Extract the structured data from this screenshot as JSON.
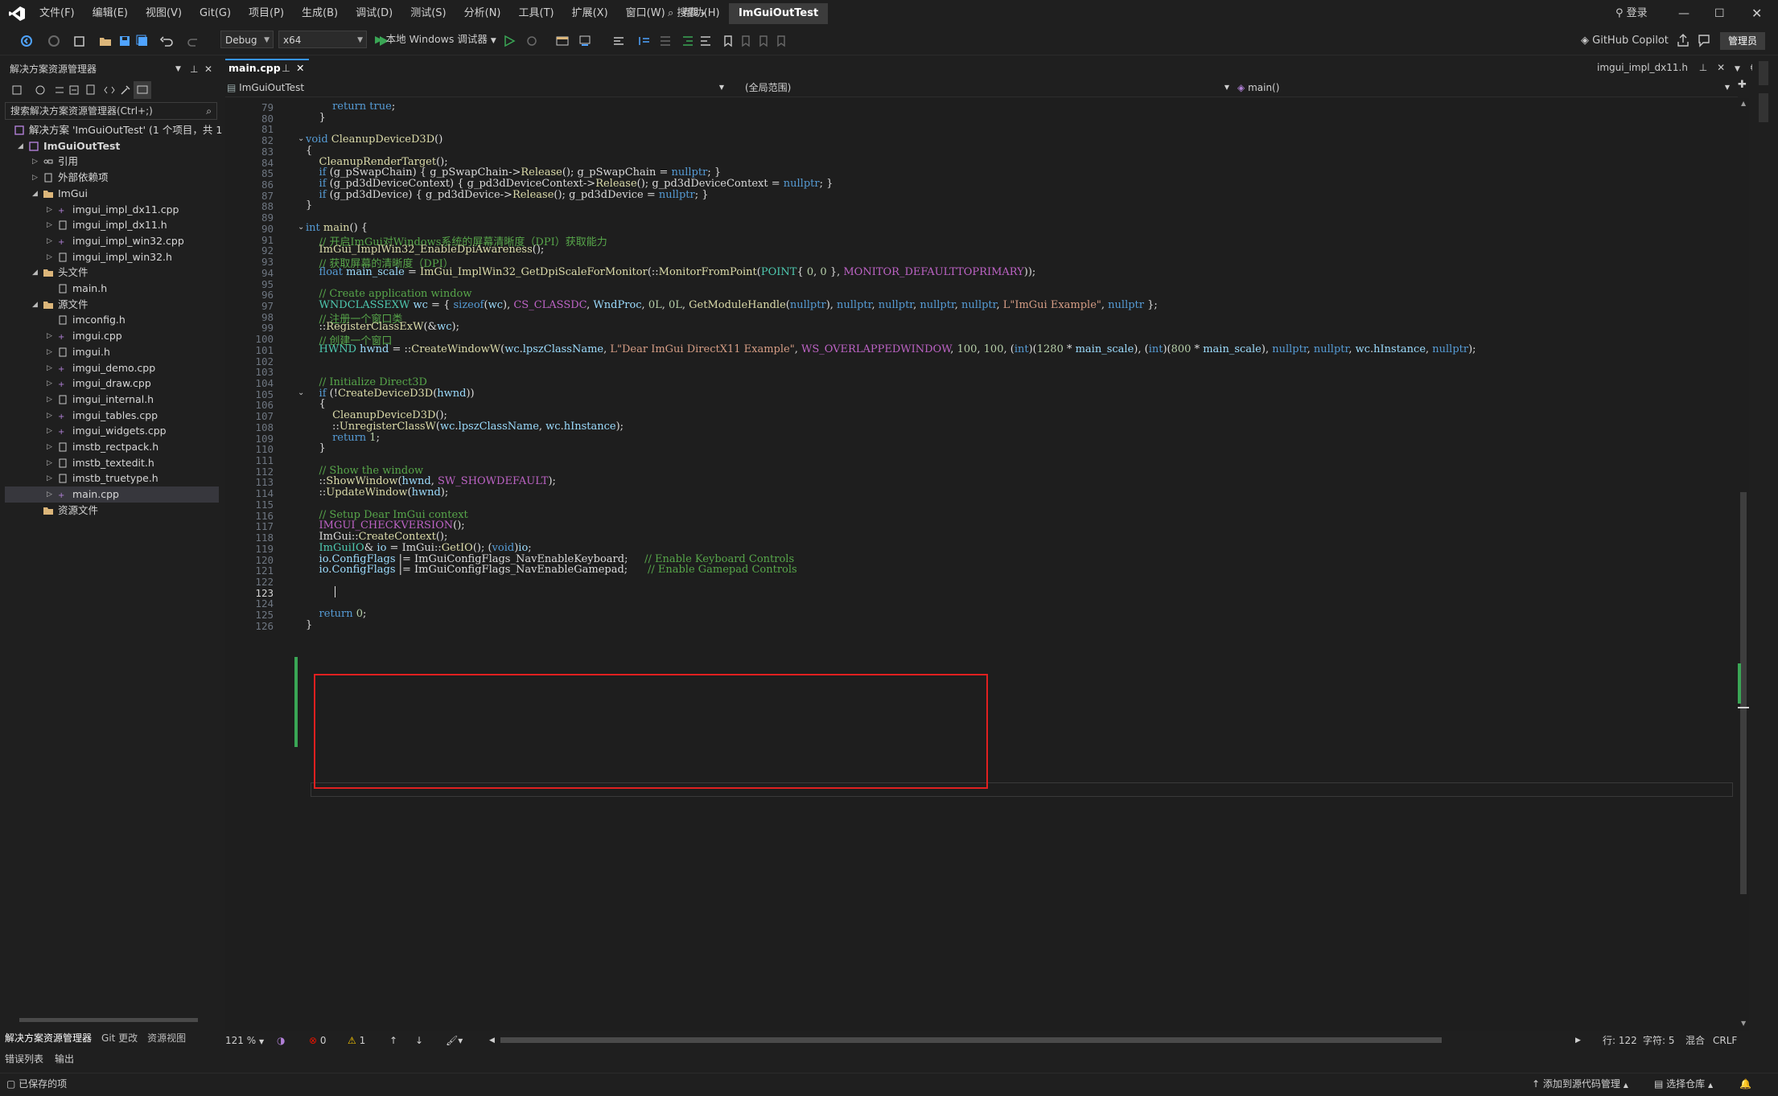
{
  "app": {
    "logo": "visual-studio-logo",
    "menu": [
      "文件(F)",
      "编辑(E)",
      "视图(V)",
      "Git(G)",
      "项目(P)",
      "生成(B)",
      "调试(D)",
      "测试(S)",
      "分析(N)",
      "工具(T)",
      "扩展(X)",
      "窗口(W)",
      "帮助(H)"
    ],
    "search_label": "搜索",
    "solution_name": "ImGuiOutTest",
    "login_label": "登录",
    "copilot_label": "GitHub Copilot",
    "admin_label": "管理员"
  },
  "toolbar": {
    "config": "Debug",
    "platform": "x64",
    "run_label": "本地 Windows 调试器"
  },
  "solution_explorer": {
    "title": "解决方案资源管理器",
    "search_placeholder": "搜索解决方案资源管理器(Ctrl+;)",
    "tree": [
      {
        "label": "解决方案 'ImGuiOutTest' (1 个项目，共 1",
        "depth": 0,
        "type": "solution"
      },
      {
        "label": "ImGuiOutTest",
        "depth": 1,
        "type": "project",
        "bold": true
      },
      {
        "label": "引用",
        "depth": 2,
        "type": "ref"
      },
      {
        "label": "外部依赖项",
        "depth": 2,
        "type": "deps"
      },
      {
        "label": "ImGui",
        "depth": 2,
        "type": "filter",
        "open": true
      },
      {
        "label": "imgui_impl_dx11.cpp",
        "depth": 3,
        "type": "cpp"
      },
      {
        "label": "imgui_impl_dx11.h",
        "depth": 3,
        "type": "h"
      },
      {
        "label": "imgui_impl_win32.cpp",
        "depth": 3,
        "type": "cpp"
      },
      {
        "label": "imgui_impl_win32.h",
        "depth": 3,
        "type": "h"
      },
      {
        "label": "头文件",
        "depth": 2,
        "type": "filter",
        "open": true
      },
      {
        "label": "main.h",
        "depth": 3,
        "type": "h"
      },
      {
        "label": "源文件",
        "depth": 2,
        "type": "filter",
        "open": true
      },
      {
        "label": "imconfig.h",
        "depth": 3,
        "type": "h"
      },
      {
        "label": "imgui.cpp",
        "depth": 3,
        "type": "cpp"
      },
      {
        "label": "imgui.h",
        "depth": 3,
        "type": "h"
      },
      {
        "label": "imgui_demo.cpp",
        "depth": 3,
        "type": "cpp"
      },
      {
        "label": "imgui_draw.cpp",
        "depth": 3,
        "type": "cpp"
      },
      {
        "label": "imgui_internal.h",
        "depth": 3,
        "type": "h"
      },
      {
        "label": "imgui_tables.cpp",
        "depth": 3,
        "type": "cpp"
      },
      {
        "label": "imgui_widgets.cpp",
        "depth": 3,
        "type": "cpp"
      },
      {
        "label": "imstb_rectpack.h",
        "depth": 3,
        "type": "h"
      },
      {
        "label": "imstb_textedit.h",
        "depth": 3,
        "type": "h"
      },
      {
        "label": "imstb_truetype.h",
        "depth": 3,
        "type": "h"
      },
      {
        "label": "main.cpp",
        "depth": 3,
        "type": "cpp",
        "selected": true
      },
      {
        "label": "资源文件",
        "depth": 2,
        "type": "filter"
      }
    ],
    "bottom_tabs": [
      "解决方案资源管理器",
      "Git 更改",
      "资源视图"
    ]
  },
  "editor": {
    "active_tab": "main.cpp",
    "right_tab": "imgui_impl_dx11.h",
    "nav_project": "ImGuiOutTest",
    "nav_scope": "(全局范围)",
    "nav_member": "main()",
    "current_line": 123,
    "lines": [
      {
        "n": 79,
        "t": "        return true;"
      },
      {
        "n": 80,
        "t": "    }"
      },
      {
        "n": 81,
        "t": ""
      },
      {
        "n": 82,
        "t": "void CleanupDeviceD3D()"
      },
      {
        "n": 83,
        "t": "{"
      },
      {
        "n": 84,
        "t": "    CleanupRenderTarget();"
      },
      {
        "n": 85,
        "t": "    if (g_pSwapChain) { g_pSwapChain->Release(); g_pSwapChain = nullptr; }"
      },
      {
        "n": 86,
        "t": "    if (g_pd3dDeviceContext) { g_pd3dDeviceContext->Release(); g_pd3dDeviceContext = nullptr; }"
      },
      {
        "n": 87,
        "t": "    if (g_pd3dDevice) { g_pd3dDevice->Release(); g_pd3dDevice = nullptr; }"
      },
      {
        "n": 88,
        "t": "}"
      },
      {
        "n": 89,
        "t": ""
      },
      {
        "n": 90,
        "t": "int main() {"
      },
      {
        "n": 91,
        "t": "    // 开启ImGui对Windows系统的屏幕清晰度（DPI）获取能力"
      },
      {
        "n": 92,
        "t": "    ImGui_ImplWin32_EnableDpiAwareness();"
      },
      {
        "n": 93,
        "t": "    // 获取屏幕的清晰度（DPI）"
      },
      {
        "n": 94,
        "t": "    float main_scale = ImGui_ImplWin32_GetDpiScaleForMonitor(::MonitorFromPoint(POINT{ 0, 0 }, MONITOR_DEFAULTTOPRIMARY));"
      },
      {
        "n": 95,
        "t": ""
      },
      {
        "n": 96,
        "t": "    // Create application window"
      },
      {
        "n": 97,
        "t": "    WNDCLASSEXW wc = { sizeof(wc), CS_CLASSDC, WndProc, 0L, 0L, GetModuleHandle(nullptr), nullptr, nullptr, nullptr, nullptr, L\"ImGui Example\", nullptr };"
      },
      {
        "n": 98,
        "t": "    // 注册一个窗口类"
      },
      {
        "n": 99,
        "t": "    ::RegisterClassExW(&wc);"
      },
      {
        "n": 100,
        "t": "    // 创建一个窗口"
      },
      {
        "n": 101,
        "t": "    HWND hwnd = ::CreateWindowW(wc.lpszClassName, L\"Dear ImGui DirectX11 Example\", WS_OVERLAPPEDWINDOW, 100, 100, (int)(1280 * main_scale), (int)(800 * main_scale), nullptr, nullptr, wc.hInstance, nullptr);"
      },
      {
        "n": 102,
        "t": ""
      },
      {
        "n": 103,
        "t": ""
      },
      {
        "n": 104,
        "t": "    // Initialize Direct3D"
      },
      {
        "n": 105,
        "t": "    if (!CreateDeviceD3D(hwnd))"
      },
      {
        "n": 106,
        "t": "    {"
      },
      {
        "n": 107,
        "t": "        CleanupDeviceD3D();"
      },
      {
        "n": 108,
        "t": "        ::UnregisterClassW(wc.lpszClassName, wc.hInstance);"
      },
      {
        "n": 109,
        "t": "        return 1;"
      },
      {
        "n": 110,
        "t": "    }"
      },
      {
        "n": 111,
        "t": ""
      },
      {
        "n": 112,
        "t": "    // Show the window"
      },
      {
        "n": 113,
        "t": "    ::ShowWindow(hwnd, SW_SHOWDEFAULT);"
      },
      {
        "n": 114,
        "t": "    ::UpdateWindow(hwnd);"
      },
      {
        "n": 115,
        "t": ""
      },
      {
        "n": 116,
        "t": "    // Setup Dear ImGui context"
      },
      {
        "n": 117,
        "t": "    IMGUI_CHECKVERSION();"
      },
      {
        "n": 118,
        "t": "    ImGui::CreateContext();"
      },
      {
        "n": 119,
        "t": "    ImGuiIO& io = ImGui::GetIO(); (void)io;"
      },
      {
        "n": 120,
        "t": "    io.ConfigFlags |= ImGuiConfigFlags_NavEnableKeyboard;     // Enable Keyboard Controls"
      },
      {
        "n": 121,
        "t": "    io.ConfigFlags |= ImGuiConfigFlags_NavEnableGamepad;      // Enable Gamepad Controls"
      },
      {
        "n": 122,
        "t": ""
      },
      {
        "n": 123,
        "t": "    "
      },
      {
        "n": 124,
        "t": ""
      },
      {
        "n": 125,
        "t": "    return 0;"
      },
      {
        "n": 126,
        "t": "}"
      }
    ]
  },
  "editor_status": {
    "zoom": "121 %",
    "errors": "0",
    "warnings": "1",
    "line": "行: 122",
    "col": "字符: 5",
    "mixed": "混合",
    "eol": "CRLF"
  },
  "bottom_panel_tabs": [
    "错误列表",
    "输出"
  ],
  "statusbar": {
    "left": "已保存的项",
    "add_source": "添加到源代码管理",
    "select_repo": "选择仓库"
  },
  "colors": {
    "accent": "#3794ff",
    "highlight_box": "#e02020",
    "change_bar": "#3aa655"
  }
}
